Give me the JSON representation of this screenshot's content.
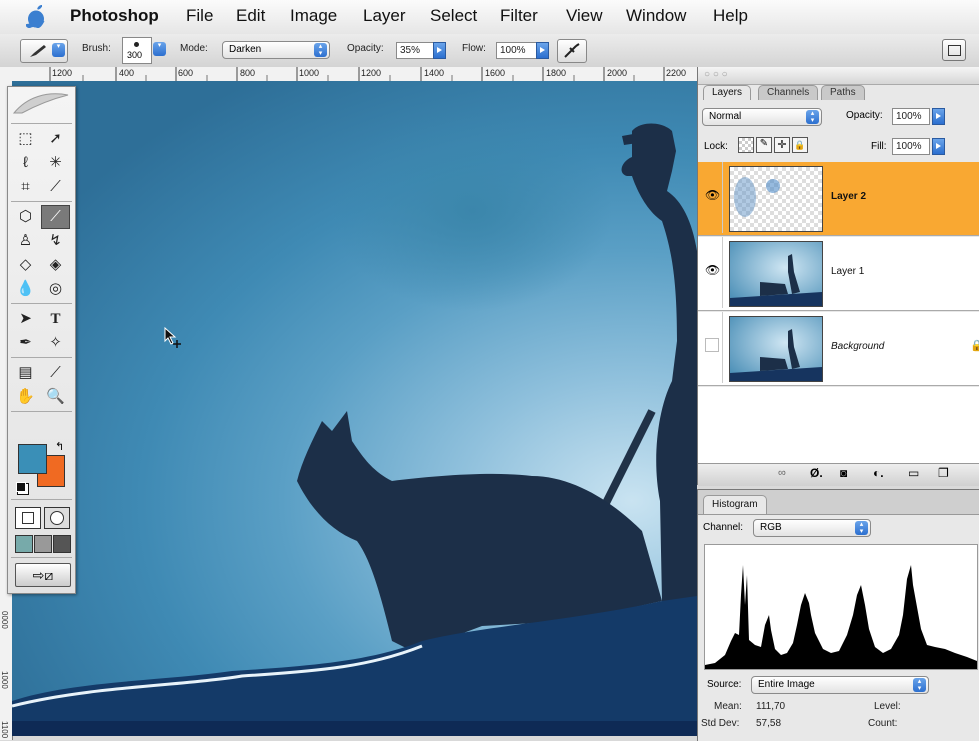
{
  "menubar": {
    "app_name": "Photoshop",
    "items": [
      "File",
      "Edit",
      "Image",
      "Layer",
      "Select",
      "Filter",
      "View",
      "Window",
      "Help"
    ]
  },
  "options": {
    "brush_label": "Brush:",
    "brush_size": "300",
    "mode_label": "Mode:",
    "mode_value": "Darken",
    "opacity_label": "Opacity:",
    "opacity_value": "35%",
    "flow_label": "Flow:",
    "flow_value": "100%"
  },
  "ruler": {
    "labels": [
      "1200",
      "400",
      "600",
      "800",
      "1000",
      "1200",
      "1400",
      "1600",
      "1800",
      "2000",
      "2200"
    ]
  },
  "vruler": {
    "labels": [
      "0000",
      "1000",
      "1100"
    ]
  },
  "colors": {
    "foreground": "#3a8fb7",
    "background": "#f06a22",
    "selected_layer": "#f9a832"
  },
  "layers_panel": {
    "tabs": [
      "Layers",
      "Channels",
      "Paths"
    ],
    "blend_mode": "Normal",
    "opacity_label": "Opacity:",
    "opacity_value": "100%",
    "lock_label": "Lock:",
    "fill_label": "Fill:",
    "fill_value": "100%",
    "layers": [
      {
        "name": "Layer 2",
        "visible": true,
        "selected": true
      },
      {
        "name": "Layer 1",
        "visible": true,
        "selected": false
      },
      {
        "name": "Background",
        "visible": false,
        "selected": false
      }
    ]
  },
  "histogram_panel": {
    "tab": "Histogram",
    "channel_label": "Channel:",
    "channel_value": "RGB",
    "source_label": "Source:",
    "source_value": "Entire Image",
    "mean_label": "Mean:",
    "mean_value": "111,70",
    "stddev_label": "Std Dev:",
    "stddev_value": "57,58",
    "level_label": "Level:",
    "count_label": "Count:"
  },
  "tools": [
    "marquee-icon",
    "move-icon",
    "lasso-icon",
    "magic-wand-icon",
    "crop-icon",
    "slice-icon",
    "healing-icon",
    "brush-icon",
    "stamp-icon",
    "history-brush-icon",
    "eraser-icon",
    "paint-bucket-icon",
    "blur-icon",
    "dodge-icon",
    "path-select-icon",
    "type-icon",
    "pen-icon",
    "shape-icon",
    "notes-icon",
    "eyedropper-icon",
    "hand-icon",
    "zoom-icon"
  ]
}
